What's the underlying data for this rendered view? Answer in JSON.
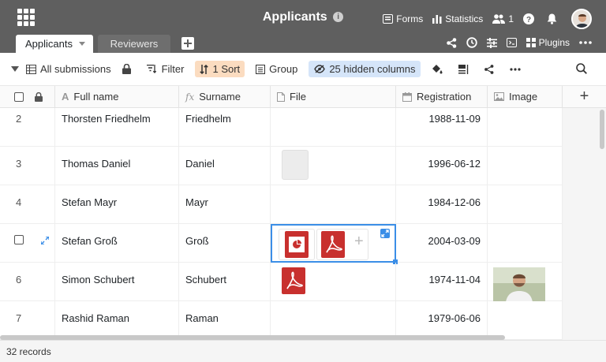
{
  "header": {
    "title": "Applicants",
    "forms_label": "Forms",
    "statistics_label": "Statistics",
    "collaborators_count": "1"
  },
  "tabs": [
    {
      "label": "Applicants",
      "active": true
    },
    {
      "label": "Reviewers",
      "active": false
    }
  ],
  "tabs_right": {
    "plugins_label": "Plugins"
  },
  "toolbar": {
    "view_label": "All submissions",
    "filter_label": "Filter",
    "sort_label": "1 Sort",
    "group_label": "Group",
    "hidden_label": "25 hidden columns"
  },
  "columns": [
    {
      "label": "Full name",
      "icon": "text-icon"
    },
    {
      "label": "Surname",
      "icon": "formula-icon"
    },
    {
      "label": "File",
      "icon": "file-icon"
    },
    {
      "label": "Registration",
      "icon": "date-icon"
    },
    {
      "label": "Image",
      "icon": "image-icon"
    }
  ],
  "rows": [
    {
      "num": "2",
      "full_name": "Thorsten Friedhelm",
      "surname": "Friedhelm",
      "registration": "1988-11-09",
      "files": [],
      "image": false
    },
    {
      "num": "3",
      "full_name": "Thomas Daniel",
      "surname": "Daniel",
      "registration": "1996-06-12",
      "files": [
        "blank"
      ],
      "image": false
    },
    {
      "num": "4",
      "full_name": "Stefan Mayr",
      "surname": "Mayr",
      "registration": "1984-12-06",
      "files": [],
      "image": false
    },
    {
      "num": "",
      "full_name": "Stefan Groß",
      "surname": "Groß",
      "registration": "2004-03-09",
      "files": [
        "ppt",
        "pdf"
      ],
      "image": false,
      "selected": true
    },
    {
      "num": "6",
      "full_name": "Simon Schubert",
      "surname": "Schubert",
      "registration": "1974-11-04",
      "files": [
        "pdf"
      ],
      "image": true
    },
    {
      "num": "7",
      "full_name": "Rashid Raman",
      "surname": "Raman",
      "registration": "1979-06-06",
      "files": [],
      "image": false
    }
  ],
  "status": {
    "records": "32 records"
  },
  "colors": {
    "header_bg": "#5f5f5f",
    "sort_pill": "#fbdcc0",
    "hidden_pill": "#d5e5f9",
    "selection": "#3b8ee7",
    "pdf_red": "#c8302e"
  }
}
